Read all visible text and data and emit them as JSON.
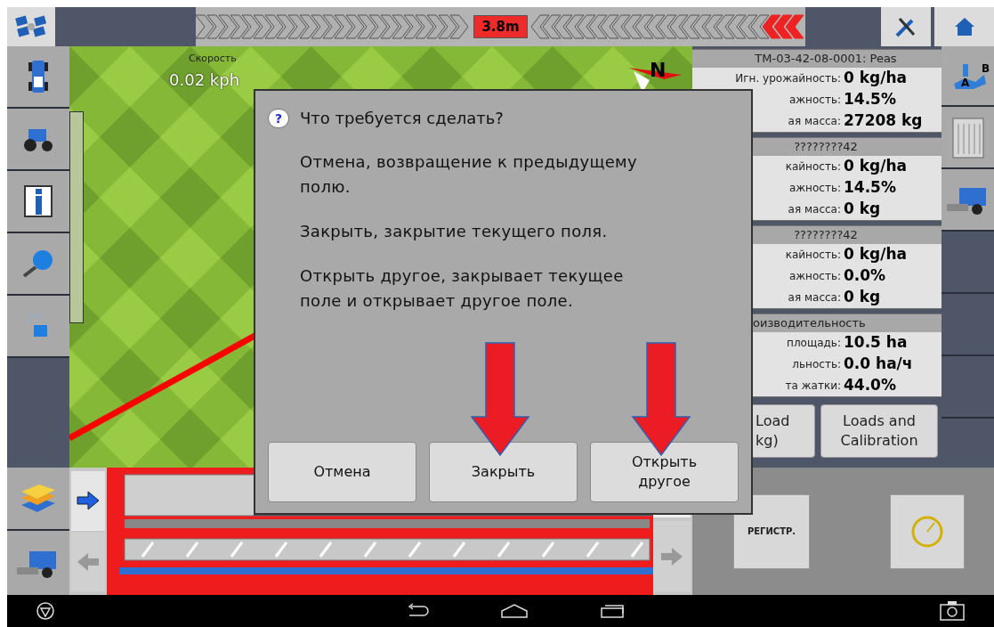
{
  "top_bar": {
    "offset_badge": "3.8m"
  },
  "map": {
    "speed_label": "Скорость",
    "speed_value": "0.02 kph",
    "compass_letter": "N"
  },
  "right_column": {
    "ab_labels": [
      "A",
      "B"
    ]
  },
  "info_panel": {
    "sections": [
      {
        "title": "ТМ-03-42-08-0001: Peas",
        "kind": "record",
        "rows": [
          {
            "label": "Игн. урожайность:",
            "value": "0 kg/ha"
          },
          {
            "label": "ажность:",
            "value": "14.5%"
          },
          {
            "label": "ая масса:",
            "value": "27208 kg"
          }
        ]
      },
      {
        "title": "????????42",
        "kind": "record",
        "rows": [
          {
            "label": "кайность:",
            "value": "0 kg/ha"
          },
          {
            "label": "ажность:",
            "value": "14.5%"
          },
          {
            "label": "ая масса:",
            "value": "0 kg"
          }
        ]
      },
      {
        "title": "????????42",
        "kind": "record",
        "rows": [
          {
            "label": "кайность:",
            "value": "0 kg/ha"
          },
          {
            "label": "ажность:",
            "value": "0.0%"
          },
          {
            "label": "ая масса:",
            "value": "0 kg"
          }
        ]
      },
      {
        "title": "оизводительность",
        "kind": "summary",
        "rows": [
          {
            "label": "площадь:",
            "value": "10.5 ha"
          },
          {
            "label": "льность:",
            "value": "0.0 ha/ч"
          },
          {
            "label": "та жатки:",
            "value": "44.0%"
          }
        ]
      }
    ],
    "buttons": [
      {
        "lines": [
          "Load",
          "kg)"
        ]
      },
      {
        "lines": [
          "Loads and",
          "Calibration"
        ]
      }
    ]
  },
  "bottom_panel": {
    "register_button": "РЕГИСТР."
  },
  "dialog": {
    "icon_glyph": "?",
    "title": "Что требуется сделать?",
    "paragraphs": [
      "Отмена, возвращение к предыдущему полю.",
      "Закрыть, закрытие текущего поля.",
      "Открыть другое, закрывает текущее поле и открывает другое поле."
    ],
    "buttons": [
      {
        "label": "Отмена",
        "highlighted": false
      },
      {
        "label": "Закрыть",
        "highlighted": true
      },
      {
        "label": "Открыть другое",
        "highlighted": true
      }
    ]
  }
}
